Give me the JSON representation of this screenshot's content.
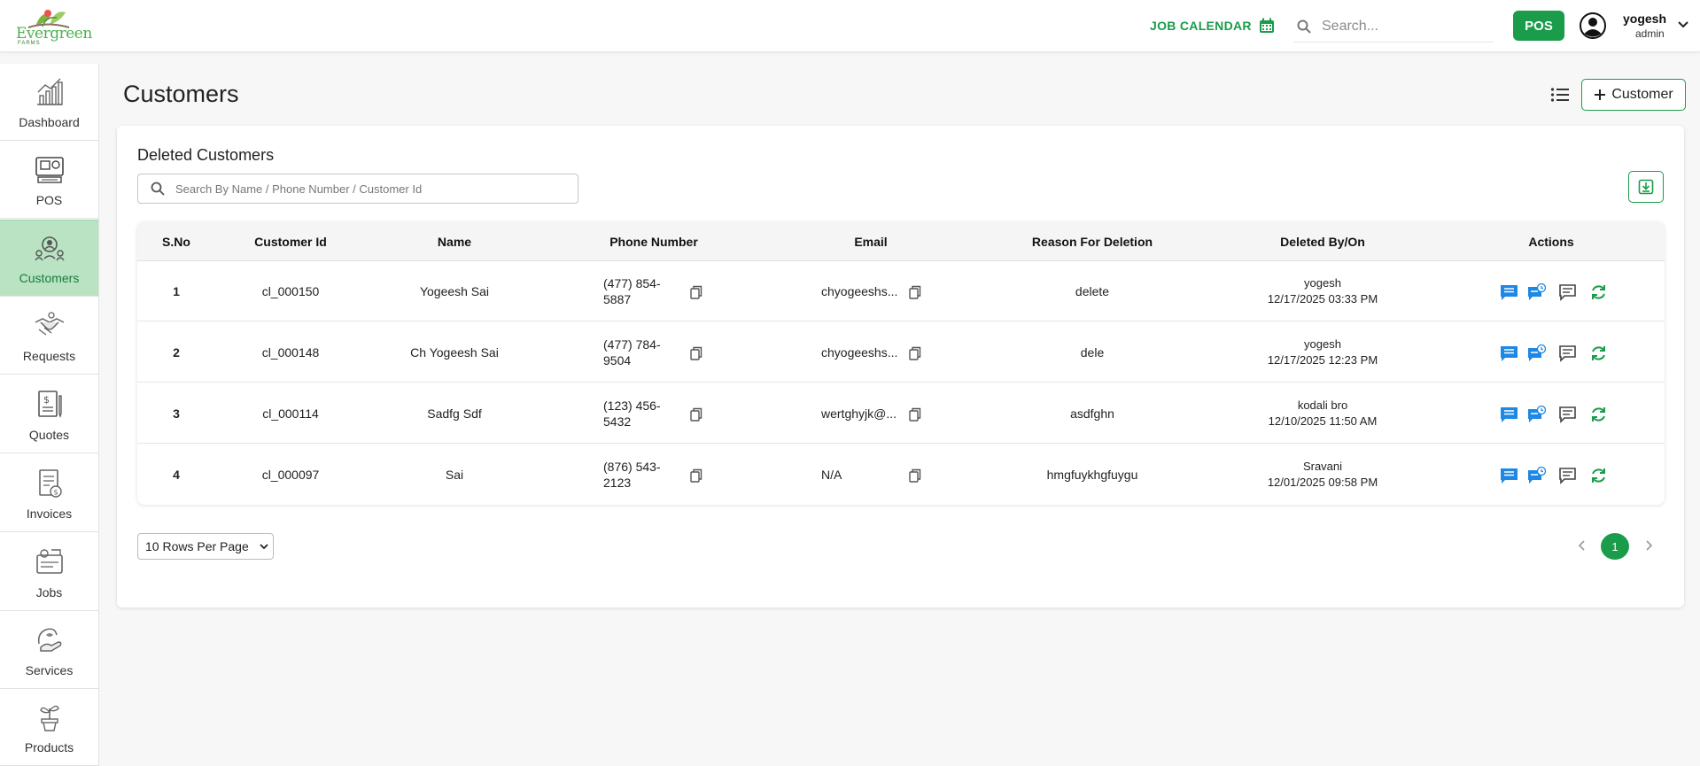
{
  "brand": {
    "logo_text": "Evergreen",
    "logo_sub": "FARMS"
  },
  "header": {
    "job_calendar_label": "JOB CALENDAR",
    "search_placeholder": "Search...",
    "pos_label": "POS",
    "user_name": "yogesh",
    "user_role": "admin"
  },
  "sidebar": {
    "items": [
      {
        "label": "Dashboard",
        "icon": "chart-icon"
      },
      {
        "label": "POS",
        "icon": "pos-terminal-icon"
      },
      {
        "label": "Customers",
        "icon": "customers-icon",
        "active": true
      },
      {
        "label": "Requests",
        "icon": "handshake-icon"
      },
      {
        "label": "Quotes",
        "icon": "quote-document-icon"
      },
      {
        "label": "Invoices",
        "icon": "invoice-icon"
      },
      {
        "label": "Jobs",
        "icon": "jobs-icon"
      },
      {
        "label": "Services",
        "icon": "services-icon"
      },
      {
        "label": "Products",
        "icon": "plant-pot-icon"
      }
    ]
  },
  "page": {
    "title": "Customers",
    "add_button_label": "Customer"
  },
  "card": {
    "title": "Deleted Customers",
    "search_placeholder": "Search By Name / Phone Number / Customer Id"
  },
  "table": {
    "columns": [
      "S.No",
      "Customer Id",
      "Name",
      "Phone Number",
      "Email",
      "Reason For Deletion",
      "Deleted By/On",
      "Actions"
    ],
    "rows": [
      {
        "sno": "1",
        "customer_id": "cl_000150",
        "name": "Yogeesh Sai",
        "phone_line1": "(477) 854-",
        "phone_line2": "5887",
        "email": "chyogeeshs...",
        "reason": "delete",
        "deleted_by": "yogesh",
        "deleted_on": "12/17/2025 03:33 PM"
      },
      {
        "sno": "2",
        "customer_id": "cl_000148",
        "name": "Ch Yogeesh Sai",
        "phone_line1": "(477) 784-",
        "phone_line2": "9504",
        "email": "chyogeeshs...",
        "reason": "dele",
        "deleted_by": "yogesh",
        "deleted_on": "12/17/2025 12:23 PM"
      },
      {
        "sno": "3",
        "customer_id": "cl_000114",
        "name": "Sadfg Sdf",
        "phone_line1": "(123) 456-",
        "phone_line2": "5432",
        "email": "wertghyjk@...",
        "reason": "asdfghn",
        "deleted_by": "kodali bro",
        "deleted_on": "12/10/2025 11:50 AM"
      },
      {
        "sno": "4",
        "customer_id": "cl_000097",
        "name": "Sai",
        "phone_line1": "(876) 543-",
        "phone_line2": "2123",
        "email": "N/A",
        "reason": "hmgfuykhgfuygu",
        "deleted_by": "Sravani",
        "deleted_on": "12/01/2025 09:58 PM"
      }
    ]
  },
  "pagination": {
    "rows_per_page": "10 Rows Per Page",
    "current_page": "1"
  },
  "colors": {
    "accent": "#1a9c4a",
    "active_nav": "#b9e3c3",
    "sms_icon": "#1e88e5"
  }
}
